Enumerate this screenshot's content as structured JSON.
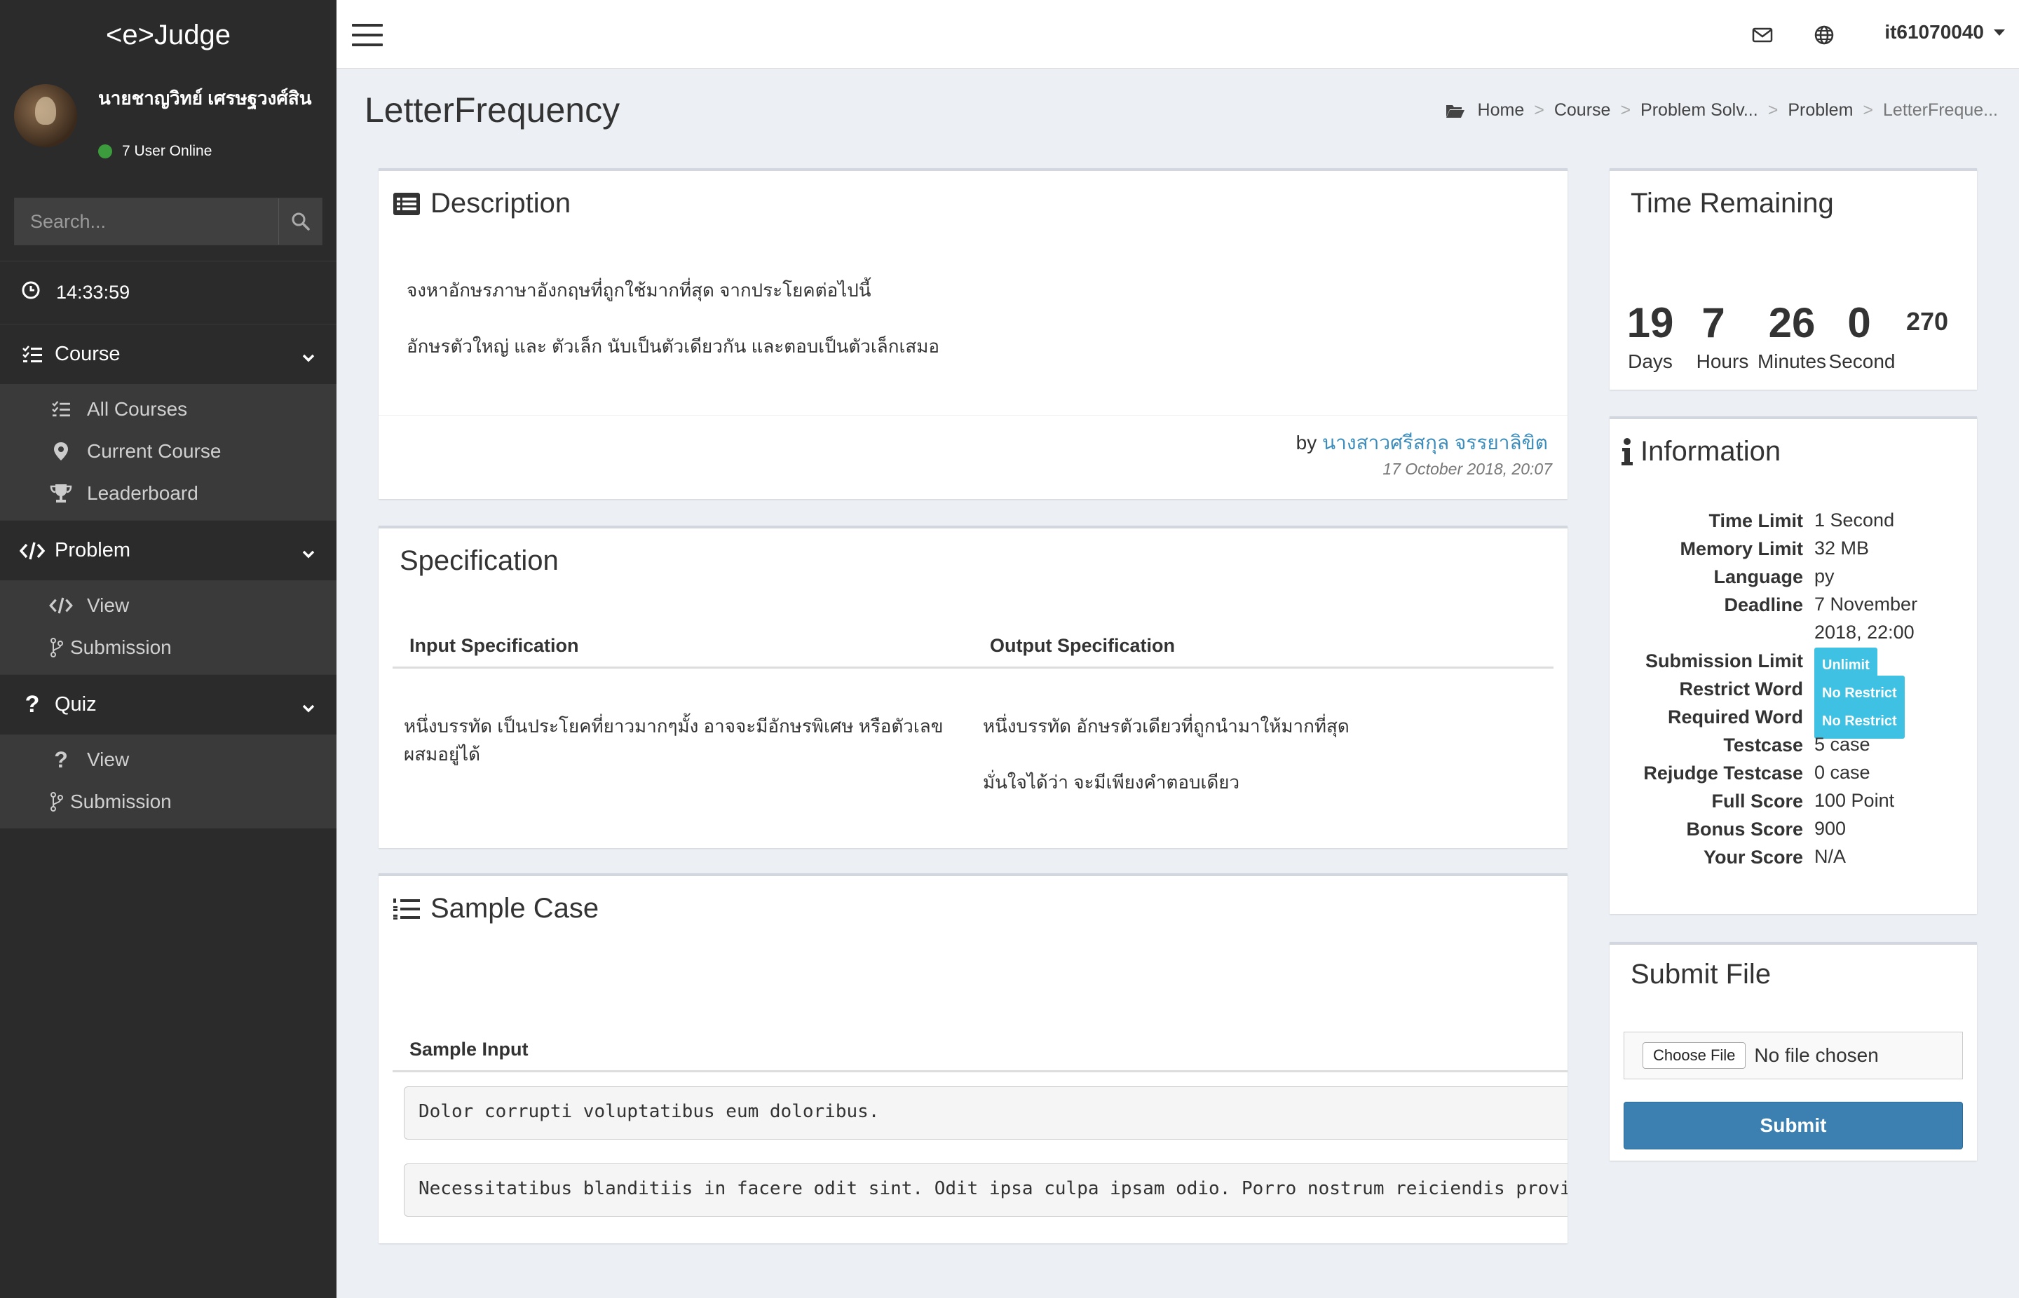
{
  "app": {
    "logo": "<e>Judge"
  },
  "user": {
    "name": "นายชาญวิทย์ เศรษฐวงศ์สิน",
    "online": "7 User Online"
  },
  "search": {
    "placeholder": "Search..."
  },
  "clock": {
    "time": "14:33:59"
  },
  "sidebar": {
    "course": {
      "label": "Course",
      "items": [
        "All Courses",
        "Current Course",
        "Leaderboard"
      ]
    },
    "problem": {
      "label": "Problem",
      "items": [
        "View",
        "Submission"
      ]
    },
    "quiz": {
      "label": "Quiz",
      "items": [
        "View",
        "Submission"
      ]
    }
  },
  "topbar": {
    "username": "it61070040"
  },
  "page": {
    "title": "LetterFrequency",
    "breadcrumb": [
      "Home",
      "Course",
      "Problem Solv...",
      "Problem",
      "LetterFreque..."
    ]
  },
  "description": {
    "title": "Description",
    "lines": [
      "จงหาอักษรภาษาอังกฤษที่ถูกใช้มากที่สุด จากประโยคต่อไปนี้",
      "อักษรตัวใหญ่ และ ตัวเล็ก นับเป็นตัวเดียวกัน และตอบเป็นตัวเล็กเสมอ"
    ],
    "by_prefix": "by",
    "author": "นางสาวศรีสกุล จรรยาลิขิต",
    "date": "17 October 2018, 20:07"
  },
  "specification": {
    "title": "Specification",
    "input_header": "Input Specification",
    "output_header": "Output Specification",
    "input_text_1": "หนึ่งบรรทัด เป็นประโยคที่ยาวมากๆมั้ง อาจจะมีอักษรพิเศษ หรือตัวเลข",
    "input_text_2": "ผสมอยู่ได้",
    "output_text_1": "หนึ่งบรรทัด อักษรตัวเดียวที่ถูกนำมาให้มากที่สุด",
    "output_text_2": "มั่นใจได้ว่า จะมีเพียงคำตอบเดียว"
  },
  "sample": {
    "title": "Sample Case",
    "input_header": "Sample Input",
    "inputs": [
      "Dolor corrupti voluptatibus eum doloribus.",
      "Necessitatibus blanditiis in facere odit sint. Odit ipsa culpa ipsam odio. Porro nostrum reiciendis provi"
    ]
  },
  "timer": {
    "title": "Time Remaining",
    "days": "19",
    "hours": "7",
    "minutes": "26",
    "seconds": "0",
    "ms": "270",
    "days_label": "Days",
    "hours_label": "Hours",
    "minutes_label": "Minutes",
    "seconds_label": "Second"
  },
  "information": {
    "title": "Information",
    "rows": [
      {
        "key": "Time Limit",
        "value": "1 Second"
      },
      {
        "key": "Memory Limit",
        "value": "32 MB"
      },
      {
        "key": "Language",
        "value": "py"
      },
      {
        "key": "Deadline",
        "value": "7 November",
        "value2": "2018, 22:00"
      },
      {
        "key": "Submission Limit",
        "badge": "Unlimit"
      },
      {
        "key": "Restrict Word",
        "badge": "No Restrict"
      },
      {
        "key": "Required Word",
        "badge": "No Restrict"
      },
      {
        "key": "Testcase",
        "value": "5 case"
      },
      {
        "key": "Rejudge Testcase",
        "value": "0 case"
      },
      {
        "key": "Full Score",
        "value": "100 Point"
      },
      {
        "key": "Bonus Score",
        "value": "900"
      },
      {
        "key": "Your Score",
        "value": "N/A"
      }
    ]
  },
  "submit": {
    "title": "Submit File",
    "choose_label": "Choose File",
    "no_file": "No file chosen",
    "submit_label": "Submit"
  },
  "colors": {
    "sidebar_bg": "#2b2b2b",
    "accent": "#3c7fb1",
    "badge": "#3ec1e3",
    "link": "#3c8dbc"
  }
}
